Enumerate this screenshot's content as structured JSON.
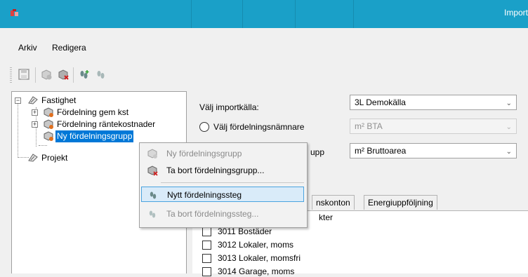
{
  "window": {
    "title": "Import"
  },
  "menu": {
    "items": [
      "Arkiv",
      "Redigera"
    ]
  },
  "toolbar": {
    "buttons": [
      "save-icon",
      "add-group-icon",
      "delete-group-icon",
      "add-step-icon",
      "delete-step-icon"
    ]
  },
  "tree": {
    "root": "Fastighet",
    "children": [
      "Fördelning gem kst",
      "Fördelning räntekostnader",
      "Ny fördelningsgrupp"
    ],
    "sibling": "Projekt"
  },
  "form": {
    "source_label": "Välj importkälla:",
    "source_value": "3L Demokälla",
    "radio1_label": "Välj fördelningsnämnare",
    "radio1_value": "m² BTA",
    "radio2_label_fragment": "upp",
    "radio2_value": "m² Bruttoarea"
  },
  "tabs": {
    "items": [
      "nskonton",
      "Energiuppföljning"
    ]
  },
  "list": {
    "header_fragment": "kter",
    "items": [
      "3011 Bostäder",
      "3012 Lokaler, moms",
      "3013 Lokaler, momsfri",
      "3014 Garage, moms"
    ]
  },
  "context_menu": {
    "items": [
      {
        "label": "Ny fördelningsgrupp",
        "enabled": false
      },
      {
        "label": "Ta bort fördelningsgrupp...",
        "enabled": true
      },
      {
        "label": "Nytt fördelningssteg",
        "enabled": true,
        "highlighted": true
      },
      {
        "label": "Ta bort fördelningssteg...",
        "enabled": false
      }
    ]
  },
  "colors": {
    "titlebar": "#1aa0c8",
    "selection": "#0078d7",
    "highlight": "#d9ebf9"
  }
}
